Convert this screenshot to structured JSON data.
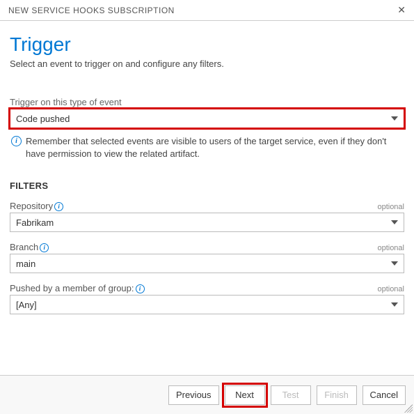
{
  "header": {
    "title": "NEW SERVICE HOOKS SUBSCRIPTION"
  },
  "page": {
    "title": "Trigger",
    "description": "Select an event to trigger on and configure any filters."
  },
  "eventField": {
    "label": "Trigger on this type of event",
    "value": "Code pushed"
  },
  "infoText": "Remember that selected events are visible to users of the target service, even if they don't have permission to view the related artifact.",
  "filters": {
    "heading": "FILTERS",
    "optionalTag": "optional",
    "repository": {
      "label": "Repository",
      "value": "Fabrikam"
    },
    "branch": {
      "label": "Branch",
      "value": "main"
    },
    "group": {
      "label": "Pushed by a member of group:",
      "value": "[Any]"
    }
  },
  "footer": {
    "previous": "Previous",
    "next": "Next",
    "test": "Test",
    "finish": "Finish",
    "cancel": "Cancel"
  }
}
